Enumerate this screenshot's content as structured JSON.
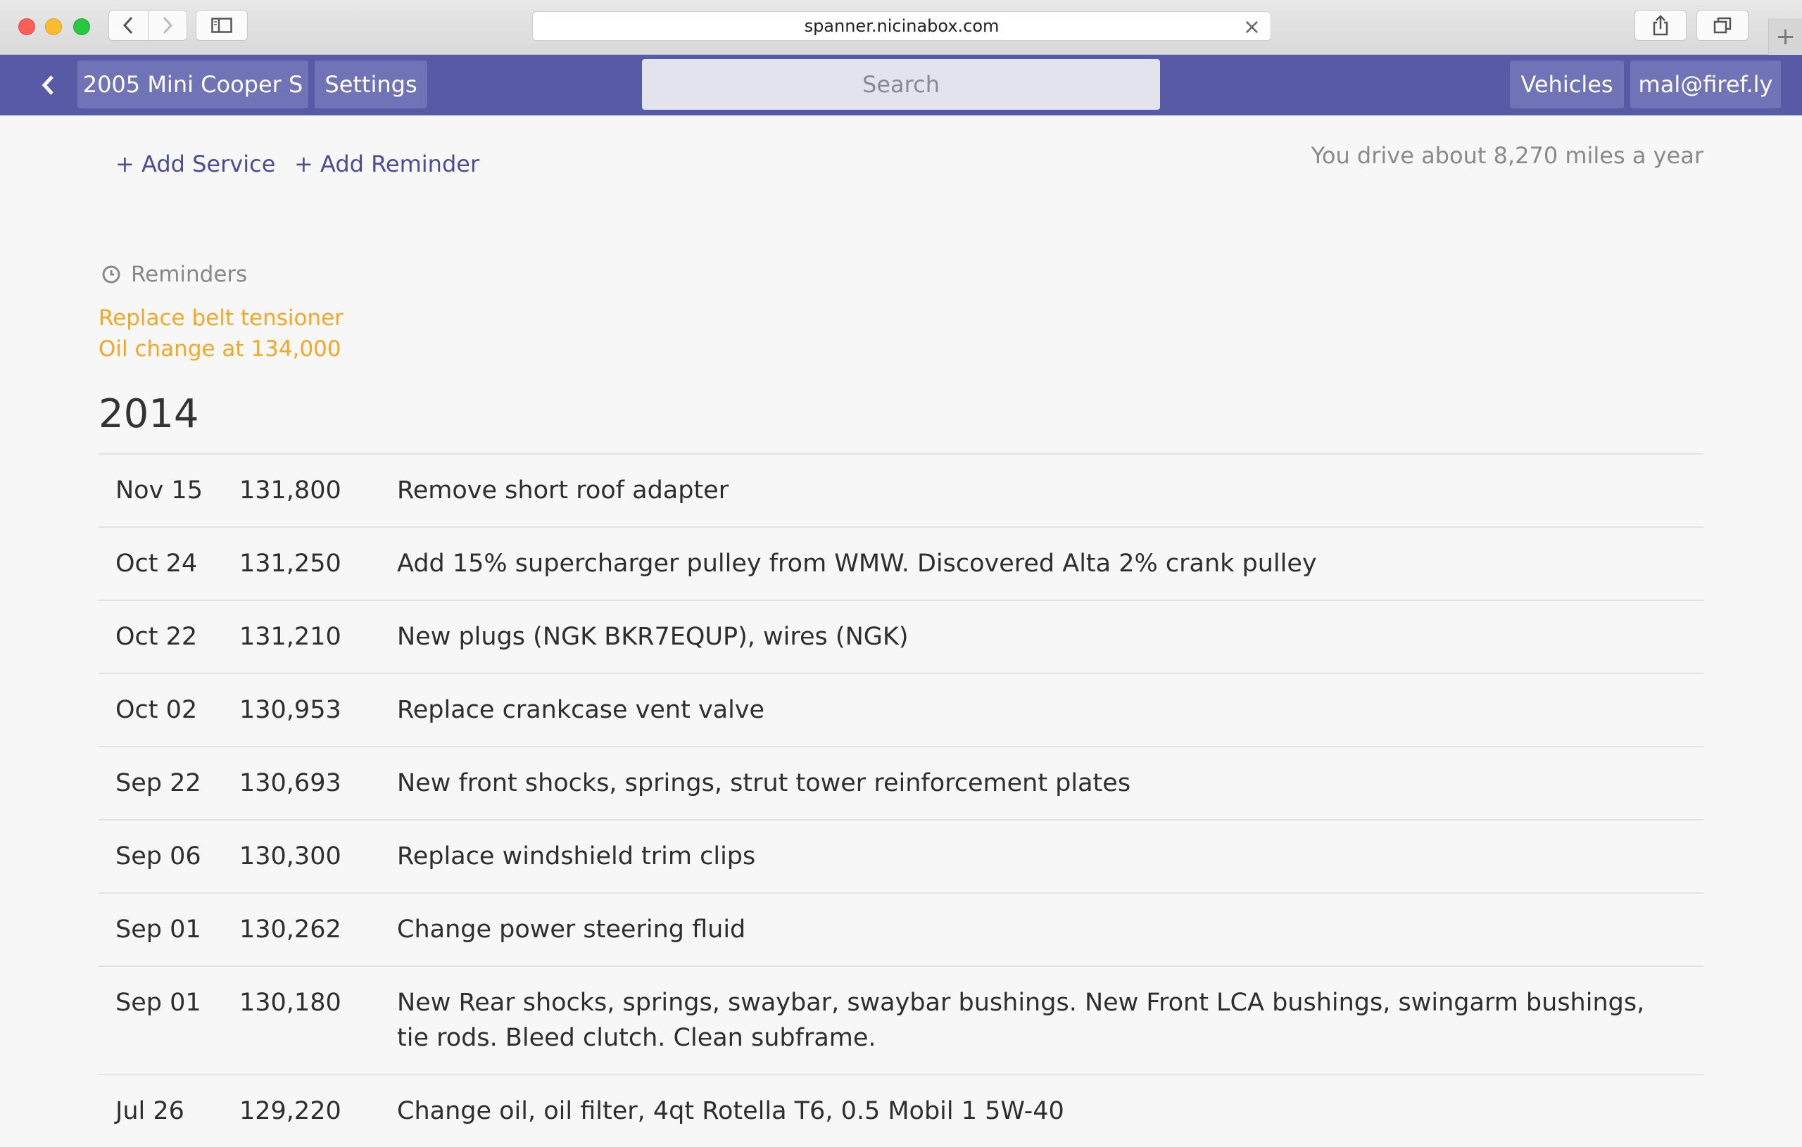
{
  "browser": {
    "url": "spanner.nicinabox.com"
  },
  "header": {
    "vehicle_label": "2005 Mini Cooper S",
    "settings_label": "Settings",
    "search_placeholder": "Search",
    "vehicles_label": "Vehicles",
    "user_label": "mal@firef.ly",
    "accent_color": "#585aa6"
  },
  "actions": {
    "add_service": "+ Add Service",
    "add_reminder": "+ Add Reminder",
    "drive_note": "You drive about 8,270 miles a year"
  },
  "reminders": {
    "heading": "Reminders",
    "color": "#f5a623",
    "items": [
      "Replace belt tensioner",
      "Oil change at 134,000"
    ]
  },
  "services": {
    "year": "2014",
    "rows": [
      {
        "date": "Nov 15",
        "mileage": "131,800",
        "description": "Remove short roof adapter"
      },
      {
        "date": "Oct 24",
        "mileage": "131,250",
        "description": "Add 15% supercharger pulley from WMW. Discovered Alta 2% crank pulley"
      },
      {
        "date": "Oct 22",
        "mileage": "131,210",
        "description": "New plugs (NGK BKR7EQUP), wires (NGK)"
      },
      {
        "date": "Oct 02",
        "mileage": "130,953",
        "description": "Replace crankcase vent valve"
      },
      {
        "date": "Sep 22",
        "mileage": "130,693",
        "description": "New front shocks, springs, strut tower reinforcement plates"
      },
      {
        "date": "Sep 06",
        "mileage": "130,300",
        "description": "Replace windshield trim clips"
      },
      {
        "date": "Sep 01",
        "mileage": "130,262",
        "description": "Change power steering fluid"
      },
      {
        "date": "Sep 01",
        "mileage": "130,180",
        "description": "New Rear shocks, springs, swaybar, swaybar bushings. New Front LCA bushings, swingarm bushings, tie rods. Bleed clutch. Clean subframe."
      },
      {
        "date": "Jul 26",
        "mileage": "129,220",
        "description": "Change oil, oil filter, 4qt Rotella T6, 0.5 Mobil 1 5W-40"
      }
    ]
  }
}
